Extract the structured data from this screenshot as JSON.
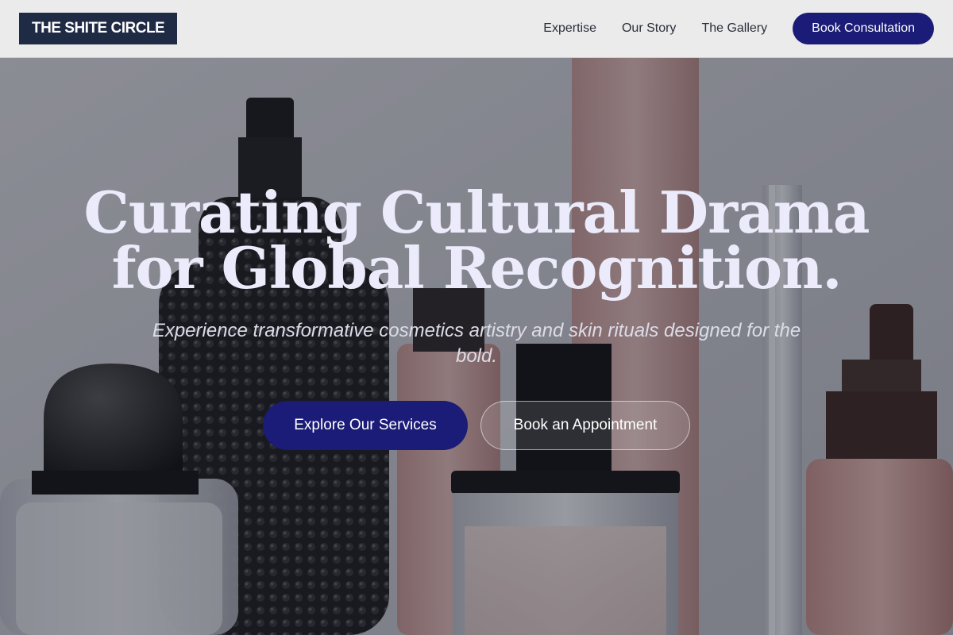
{
  "header": {
    "logo_text": "THE SHITE CIRCLE",
    "nav": [
      {
        "label": "Expertise"
      },
      {
        "label": "Our Story"
      },
      {
        "label": "The Gallery"
      }
    ],
    "cta_label": "Book Consultation"
  },
  "hero": {
    "title_line1": "Curating Cultural Drama",
    "title_line2": "for Global Recognition.",
    "subtitle": "Experience transformative cosmetics artistry and skin rituals designed for the bold.",
    "primary_button": "Explore Our Services",
    "secondary_button": "Book an Appointment"
  },
  "colors": {
    "accent": "#1b1b78",
    "logo_bg": "#1f2a44",
    "header_bg": "#ebebeb",
    "title_text": "#ecebfb"
  }
}
